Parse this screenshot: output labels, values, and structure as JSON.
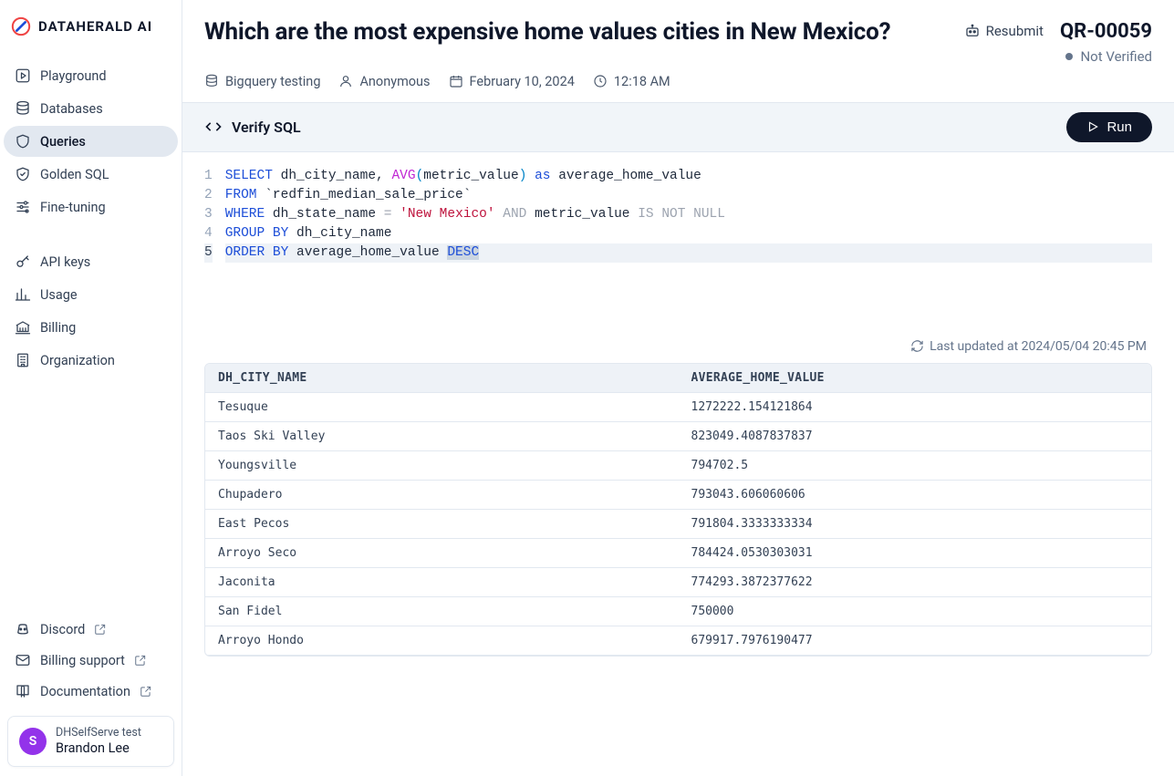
{
  "brand": {
    "name": "DATAHERALD AI"
  },
  "sidebar": {
    "primary": [
      {
        "label": "Playground",
        "icon": "play-square-icon"
      },
      {
        "label": "Databases",
        "icon": "database-icon"
      },
      {
        "label": "Queries",
        "icon": "shield-icon",
        "active": true
      },
      {
        "label": "Golden SQL",
        "icon": "shield-check-icon"
      },
      {
        "label": "Fine-tuning",
        "icon": "sliders-icon"
      }
    ],
    "secondary": [
      {
        "label": "API keys",
        "icon": "key-icon"
      },
      {
        "label": "Usage",
        "icon": "bar-chart-icon"
      },
      {
        "label": "Billing",
        "icon": "bank-icon"
      },
      {
        "label": "Organization",
        "icon": "building-icon"
      }
    ],
    "external": [
      {
        "label": "Discord",
        "icon": "discord-icon"
      },
      {
        "label": "Billing support",
        "icon": "mail-icon"
      },
      {
        "label": "Documentation",
        "icon": "book-icon"
      }
    ],
    "user": {
      "initial": "S",
      "org": "DHSelfServe test",
      "name": "Brandon Lee"
    }
  },
  "header": {
    "title": "Which are the most expensive home values cities in New Mexico?",
    "resubmit_label": "Resubmit",
    "query_id": "QR-00059",
    "status_label": "Not Verified",
    "meta": {
      "db": "Bigquery testing",
      "user": "Anonymous",
      "date": "February 10, 2024",
      "time": "12:18 AM"
    }
  },
  "verify": {
    "title": "Verify SQL",
    "run_label": "Run"
  },
  "sql": {
    "lines": [
      [
        {
          "t": "SELECT",
          "c": "kw"
        },
        {
          "t": " dh_city_name, "
        },
        {
          "t": "AVG",
          "c": "func"
        },
        {
          "t": "(",
          "c": "punc"
        },
        {
          "t": "metric_value"
        },
        {
          "t": ")",
          "c": "punc"
        },
        {
          "t": " "
        },
        {
          "t": "as",
          "c": "kw"
        },
        {
          "t": " average_home_value"
        }
      ],
      [
        {
          "t": "FROM",
          "c": "kw"
        },
        {
          "t": " `redfin_median_sale_price`"
        }
      ],
      [
        {
          "t": "WHERE",
          "c": "kw"
        },
        {
          "t": " dh_state_name "
        },
        {
          "t": "=",
          "c": "op"
        },
        {
          "t": " "
        },
        {
          "t": "'New Mexico'",
          "c": "str"
        },
        {
          "t": " "
        },
        {
          "t": "AND",
          "c": "op"
        },
        {
          "t": " metric_value "
        },
        {
          "t": "IS NOT NULL",
          "c": "op"
        }
      ],
      [
        {
          "t": "GROUP BY",
          "c": "kw"
        },
        {
          "t": " dh_city_name"
        }
      ],
      [
        {
          "t": "ORDER BY",
          "c": "kw"
        },
        {
          "t": " average_home_value "
        },
        {
          "t": "DESC",
          "c": "kw",
          "sel": true
        }
      ]
    ],
    "active_line": 5
  },
  "results": {
    "last_updated": "Last updated at 2024/05/04 20:45 PM",
    "columns": [
      "DH_CITY_NAME",
      "AVERAGE_HOME_VALUE"
    ],
    "rows": [
      [
        "Tesuque",
        "1272222.154121864"
      ],
      [
        "Taos Ski Valley",
        "823049.4087837837"
      ],
      [
        "Youngsville",
        "794702.5"
      ],
      [
        "Chupadero",
        "793043.606060606"
      ],
      [
        "East Pecos",
        "791804.3333333334"
      ],
      [
        "Arroyo Seco",
        "784424.0530303031"
      ],
      [
        "Jaconita",
        "774293.3872377622"
      ],
      [
        "San Fidel",
        "750000"
      ],
      [
        "Arroyo Hondo",
        "679917.7976190477"
      ]
    ]
  }
}
